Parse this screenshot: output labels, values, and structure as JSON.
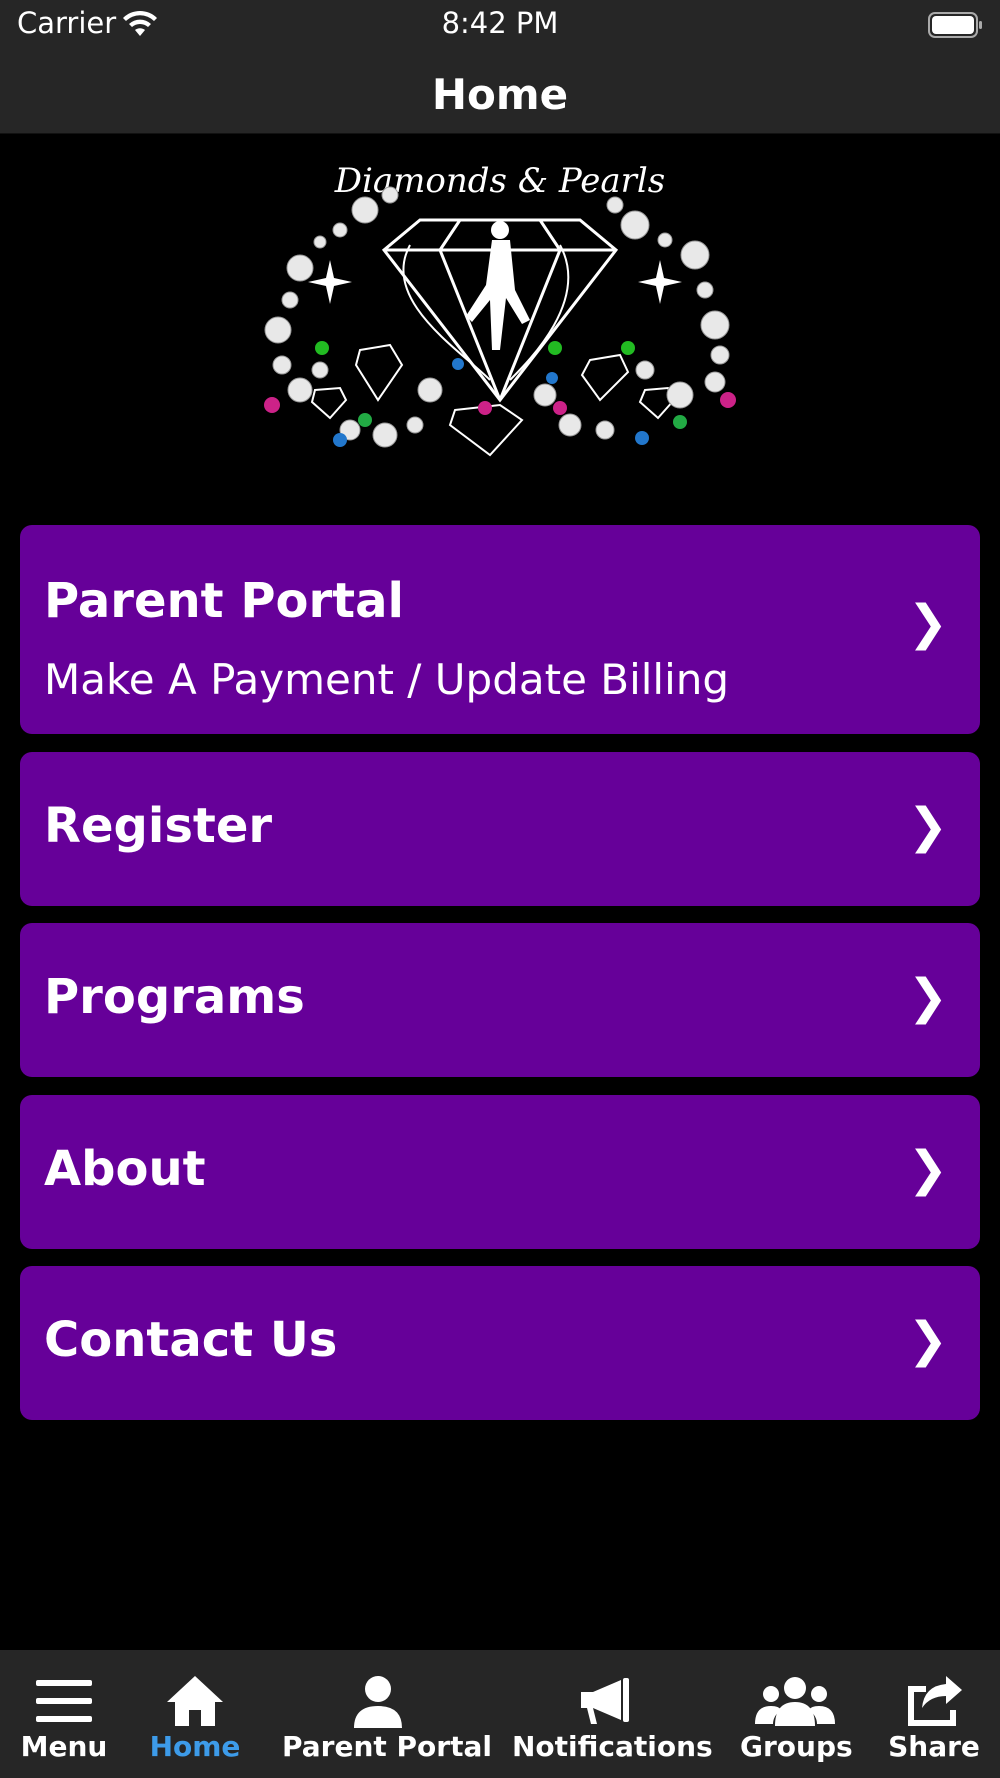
{
  "status_bar": {
    "carrier": "Carrier",
    "time": "8:42 PM"
  },
  "nav": {
    "title": "Home"
  },
  "logo": {
    "text": "Diamonds & Pearls"
  },
  "menu": [
    {
      "title": "Parent Portal",
      "subtitle": "Make A Payment / Update Billing",
      "chevron": "❯"
    },
    {
      "title": "Register",
      "chevron": "❯"
    },
    {
      "title": "Programs",
      "chevron": "❯"
    },
    {
      "title": "About",
      "chevron": "❯"
    },
    {
      "title": "Contact Us",
      "chevron": "❯"
    }
  ],
  "tabs": [
    {
      "label": "Menu",
      "icon": "hamburger-icon"
    },
    {
      "label": "Home",
      "icon": "home-icon",
      "active": true
    },
    {
      "label": "Parent Portal",
      "icon": "person-icon"
    },
    {
      "label": "Notifications",
      "icon": "megaphone-icon"
    },
    {
      "label": "Groups",
      "icon": "groups-icon"
    },
    {
      "label": "Share",
      "icon": "share-icon"
    }
  ],
  "colors": {
    "card": "#660099",
    "bars": "#262626",
    "active_tab": "#3d9be9",
    "background": "#000000"
  }
}
